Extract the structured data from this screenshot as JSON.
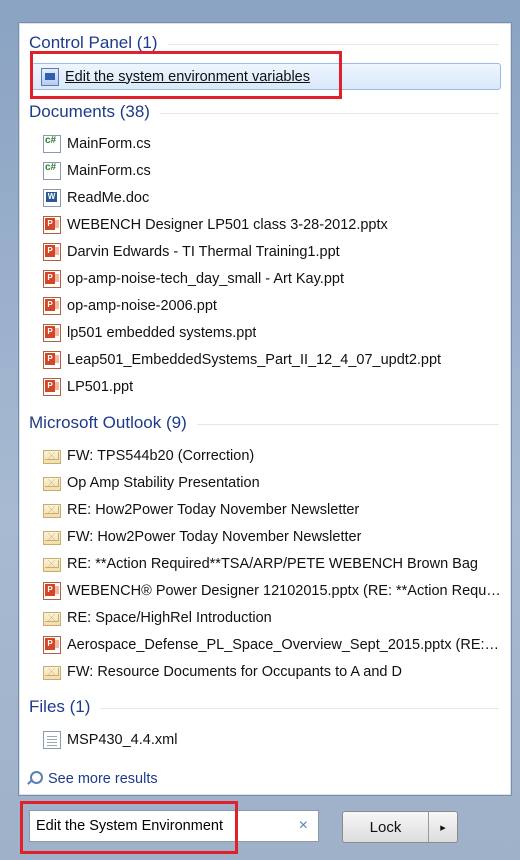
{
  "control_panel": {
    "header": "Control Panel (1)",
    "items": [
      {
        "label": "Edit the system environment variables",
        "icon": "control-panel-icon"
      }
    ]
  },
  "documents": {
    "header": "Documents (38)",
    "items": [
      {
        "label": "MainForm.cs",
        "icon": "csharp-file-icon"
      },
      {
        "label": "MainForm.cs",
        "icon": "csharp-file-icon"
      },
      {
        "label": "ReadMe.doc",
        "icon": "word-doc-icon"
      },
      {
        "label": "WEBENCH Designer LP501 class 3-28-2012.pptx",
        "icon": "powerpoint-icon"
      },
      {
        "label": "Darvin Edwards - TI Thermal Training1.ppt",
        "icon": "powerpoint-icon"
      },
      {
        "label": "op-amp-noise-tech_day_small - Art Kay.ppt",
        "icon": "powerpoint-icon"
      },
      {
        "label": "op-amp-noise-2006.ppt",
        "icon": "powerpoint-icon"
      },
      {
        "label": "lp501 embedded systems.ppt",
        "icon": "powerpoint-icon"
      },
      {
        "label": "Leap501_EmbeddedSystems_Part_II_12_4_07_updt2.ppt",
        "icon": "powerpoint-icon"
      },
      {
        "label": "LP501.ppt",
        "icon": "powerpoint-icon"
      }
    ]
  },
  "outlook": {
    "header": "Microsoft Outlook (9)",
    "items": [
      {
        "label": "FW: TPS544b20 (Correction)",
        "icon": "envelope-icon"
      },
      {
        "label": "Op Amp Stability Presentation",
        "icon": "envelope-icon"
      },
      {
        "label": "RE: How2Power Today November Newsletter",
        "icon": "envelope-icon"
      },
      {
        "label": "FW: How2Power Today November Newsletter",
        "icon": "envelope-icon"
      },
      {
        "label": "RE: **Action Required**TSA/ARP/PETE WEBENCH Brown Bag",
        "icon": "envelope-icon"
      },
      {
        "label": "WEBENCH® Power Designer 12102015.pptx (RE: **Action Requi...",
        "icon": "powerpoint-icon"
      },
      {
        "label": "RE: Space/HighRel Introduction",
        "icon": "envelope-icon"
      },
      {
        "label": "Aerospace_Defense_PL_Space_Overview_Sept_2015.pptx (RE: Sp...",
        "icon": "powerpoint-icon"
      },
      {
        "label": "FW: Resource Documents for Occupants to A and D",
        "icon": "envelope-icon"
      }
    ]
  },
  "files": {
    "header": "Files (1)",
    "items": [
      {
        "label": "MSP430_4.4.xml",
        "icon": "xml-file-icon"
      }
    ]
  },
  "see_more": "See more results",
  "search": {
    "value": "Edit the System Environment",
    "clear": "×"
  },
  "lock_button": {
    "label": "Lock",
    "arrow": "▸"
  },
  "colors": {
    "accent": "#1e3a8a",
    "highlight": "#e0202a",
    "selected_bg": "#d9e8fa"
  }
}
